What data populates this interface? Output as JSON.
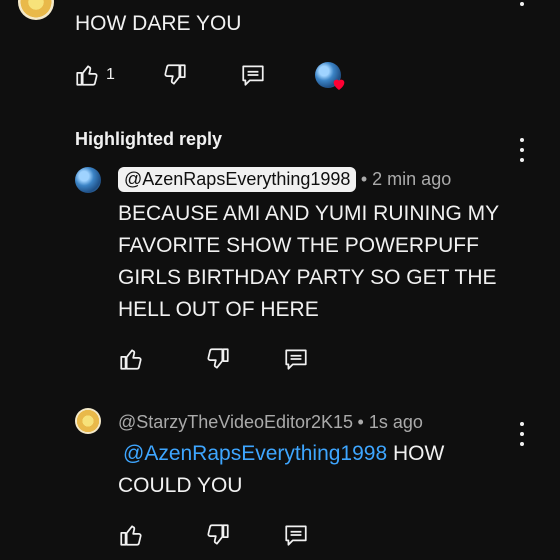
{
  "top_comment": {
    "text": "HOW DARE YOU",
    "like_count": "1"
  },
  "highlighted_reply": {
    "heading": "Highlighted reply",
    "author": "@AzenRapsEverything1998",
    "time": "• 2 min ago",
    "text_lines": [
      "BECAUSE AMI AND YUMI RUINING MY",
      "FAVORITE SHOW THE POWERPUFF",
      "GIRLS BIRTHDAY PARTY SO GET THE",
      "HELL OUT OF HERE"
    ]
  },
  "second_reply": {
    "author": "@StarzyTheVideoEditor2K15",
    "time": "• 1s ago",
    "mention": "@AzenRapsEverything1998",
    "text_after_mention": " HOW",
    "text_line2": "COULD YOU"
  },
  "colors": {
    "background": "#0f0f0f",
    "link": "#3ea6ff",
    "heart": "#ff0033"
  }
}
